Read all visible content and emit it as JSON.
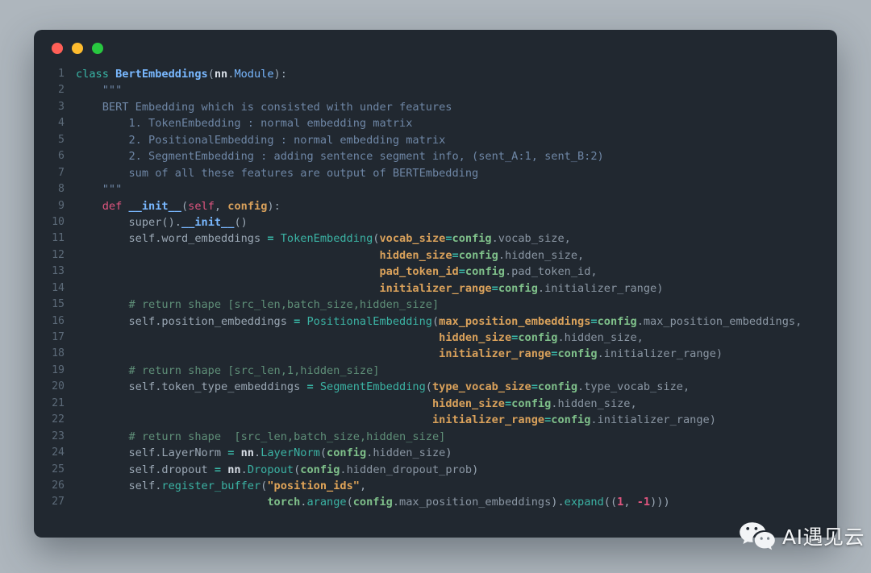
{
  "window": {
    "traffic_lights": [
      {
        "name": "close-button",
        "color": "#ff5f57"
      },
      {
        "name": "minimize-button",
        "color": "#febc2e"
      },
      {
        "name": "maximize-button",
        "color": "#28c840"
      }
    ]
  },
  "editor": {
    "background": "#212830",
    "page_background": "#aeb6bd",
    "language": "python",
    "line_numbers": [
      "1",
      "2",
      "3",
      "4",
      "5",
      "6",
      "7",
      "8",
      "9",
      "10",
      "11",
      "12",
      "13",
      "14",
      "15",
      "16",
      "17",
      "18",
      "19",
      "20",
      "21",
      "22",
      "23",
      "24",
      "25",
      "26",
      "27"
    ],
    "plain_text": "class BertEmbeddings(nn.Module):\n    \"\"\"\n    BERT Embedding which is consisted with under features\n        1. TokenEmbedding : normal embedding matrix\n        2. PositionalEmbedding : normal embedding matrix\n        2. SegmentEmbedding : adding sentence segment info, (sent_A:1, sent_B:2)\n        sum of all these features are output of BERTEmbedding\n    \"\"\"\n    def __init__(self, config):\n        super().__init__()\n        self.word_embeddings = TokenEmbedding(vocab_size=config.vocab_size,\n                                              hidden_size=config.hidden_size,\n                                              pad_token_id=config.pad_token_id,\n                                              initializer_range=config.initializer_range)\n        # return shape [src_len,batch_size,hidden_size]\n        self.position_embeddings = PositionalEmbedding(max_position_embeddings=config.max_position_embeddings,\n                                                       hidden_size=config.hidden_size,\n                                                       initializer_range=config.initializer_range)\n        # return shape [src_len,1,hidden_size]\n        self.token_type_embeddings = SegmentEmbedding(type_vocab_size=config.type_vocab_size,\n                                                      hidden_size=config.hidden_size,\n                                                      initializer_range=config.initializer_range)\n        # return shape  [src_len,batch_size,hidden_size]\n        self.LayerNorm = nn.LayerNorm(config.hidden_size)\n        self.dropout = nn.Dropout(config.hidden_dropout_prob)\n        self.register_buffer(\"position_ids\",\n                             torch.arange(config.max_position_embeddings).expand((1, -1)))",
    "lines": [
      {
        "n": "1",
        "tokens": [
          {
            "t": "class ",
            "c": "kw"
          },
          {
            "t": "BertEmbeddings",
            "c": "cls"
          },
          {
            "t": "(",
            "c": "punc"
          },
          {
            "t": "nn",
            "c": "white"
          },
          {
            "t": ".",
            "c": "punc"
          },
          {
            "t": "Module",
            "c": "type"
          },
          {
            "t": "):",
            "c": "punc"
          }
        ]
      },
      {
        "n": "2",
        "tokens": [
          {
            "t": "    \"\"\"",
            "c": "doc"
          }
        ]
      },
      {
        "n": "3",
        "tokens": [
          {
            "t": "    BERT Embedding which is consisted with under features",
            "c": "doc"
          }
        ]
      },
      {
        "n": "4",
        "tokens": [
          {
            "t": "        1. TokenEmbedding : normal embedding matrix",
            "c": "doc"
          }
        ]
      },
      {
        "n": "5",
        "tokens": [
          {
            "t": "        2. PositionalEmbedding : normal embedding matrix",
            "c": "doc"
          }
        ]
      },
      {
        "n": "6",
        "tokens": [
          {
            "t": "        2. SegmentEmbedding : adding sentence segment info, (sent_A:1, sent_B:2)",
            "c": "doc"
          }
        ]
      },
      {
        "n": "7",
        "tokens": [
          {
            "t": "        sum of all these features are output of BERTEmbedding",
            "c": "doc"
          }
        ]
      },
      {
        "n": "8",
        "tokens": [
          {
            "t": "    \"\"\"",
            "c": "doc"
          }
        ]
      },
      {
        "n": "9",
        "tokens": [
          {
            "t": "    ",
            "c": "plain"
          },
          {
            "t": "def ",
            "c": "def"
          },
          {
            "t": "__init__",
            "c": "funcb"
          },
          {
            "t": "(",
            "c": "punc"
          },
          {
            "t": "self",
            "c": "def"
          },
          {
            "t": ", ",
            "c": "punc"
          },
          {
            "t": "config",
            "c": "kwarg"
          },
          {
            "t": "):",
            "c": "punc"
          }
        ]
      },
      {
        "n": "10",
        "tokens": [
          {
            "t": "        super().",
            "c": "plain"
          },
          {
            "t": "__init__",
            "c": "funcb"
          },
          {
            "t": "()",
            "c": "punc"
          }
        ]
      },
      {
        "n": "11",
        "tokens": [
          {
            "t": "        self.word_embeddings ",
            "c": "plain"
          },
          {
            "t": "=",
            "c": "eq"
          },
          {
            "t": " ",
            "c": "plain"
          },
          {
            "t": "TokenEmbedding",
            "c": "func"
          },
          {
            "t": "(",
            "c": "punc"
          },
          {
            "t": "vocab_size",
            "c": "kwarg"
          },
          {
            "t": "=",
            "c": "eq"
          },
          {
            "t": "config",
            "c": "cfg"
          },
          {
            "t": ".vocab_size,",
            "c": "attr"
          }
        ]
      },
      {
        "n": "12",
        "tokens": [
          {
            "t": "                                              ",
            "c": "plain"
          },
          {
            "t": "hidden_size",
            "c": "kwarg"
          },
          {
            "t": "=",
            "c": "eq"
          },
          {
            "t": "config",
            "c": "cfg"
          },
          {
            "t": ".hidden_size,",
            "c": "attr"
          }
        ]
      },
      {
        "n": "13",
        "tokens": [
          {
            "t": "                                              ",
            "c": "plain"
          },
          {
            "t": "pad_token_id",
            "c": "kwarg"
          },
          {
            "t": "=",
            "c": "eq"
          },
          {
            "t": "config",
            "c": "cfg"
          },
          {
            "t": ".pad_token_id,",
            "c": "attr"
          }
        ]
      },
      {
        "n": "14",
        "tokens": [
          {
            "t": "                                              ",
            "c": "plain"
          },
          {
            "t": "initializer_range",
            "c": "kwarg"
          },
          {
            "t": "=",
            "c": "eq"
          },
          {
            "t": "config",
            "c": "cfg"
          },
          {
            "t": ".initializer_range)",
            "c": "attr"
          }
        ]
      },
      {
        "n": "15",
        "tokens": [
          {
            "t": "        # return shape [src_len,batch_size,hidden_size]",
            "c": "cmt"
          }
        ]
      },
      {
        "n": "16",
        "tokens": [
          {
            "t": "        self.position_embeddings ",
            "c": "plain"
          },
          {
            "t": "=",
            "c": "eq"
          },
          {
            "t": " ",
            "c": "plain"
          },
          {
            "t": "PositionalEmbedding",
            "c": "func"
          },
          {
            "t": "(",
            "c": "punc"
          },
          {
            "t": "max_position_embeddings",
            "c": "kwarg"
          },
          {
            "t": "=",
            "c": "eq"
          },
          {
            "t": "config",
            "c": "cfg"
          },
          {
            "t": ".max_position_embeddings,",
            "c": "attr"
          }
        ]
      },
      {
        "n": "17",
        "tokens": [
          {
            "t": "                                                       ",
            "c": "plain"
          },
          {
            "t": "hidden_size",
            "c": "kwarg"
          },
          {
            "t": "=",
            "c": "eq"
          },
          {
            "t": "config",
            "c": "cfg"
          },
          {
            "t": ".hidden_size,",
            "c": "attr"
          }
        ]
      },
      {
        "n": "18",
        "tokens": [
          {
            "t": "                                                       ",
            "c": "plain"
          },
          {
            "t": "initializer_range",
            "c": "kwarg"
          },
          {
            "t": "=",
            "c": "eq"
          },
          {
            "t": "config",
            "c": "cfg"
          },
          {
            "t": ".initializer_range)",
            "c": "attr"
          }
        ]
      },
      {
        "n": "19",
        "tokens": [
          {
            "t": "        # return shape [src_len,1,hidden_size]",
            "c": "cmt"
          }
        ]
      },
      {
        "n": "20",
        "tokens": [
          {
            "t": "        self.token_type_embeddings ",
            "c": "plain"
          },
          {
            "t": "=",
            "c": "eq"
          },
          {
            "t": " ",
            "c": "plain"
          },
          {
            "t": "SegmentEmbedding",
            "c": "func"
          },
          {
            "t": "(",
            "c": "punc"
          },
          {
            "t": "type_vocab_size",
            "c": "kwarg"
          },
          {
            "t": "=",
            "c": "eq"
          },
          {
            "t": "config",
            "c": "cfg"
          },
          {
            "t": ".type_vocab_size,",
            "c": "attr"
          }
        ]
      },
      {
        "n": "21",
        "tokens": [
          {
            "t": "                                                      ",
            "c": "plain"
          },
          {
            "t": "hidden_size",
            "c": "kwarg"
          },
          {
            "t": "=",
            "c": "eq"
          },
          {
            "t": "config",
            "c": "cfg"
          },
          {
            "t": ".hidden_size,",
            "c": "attr"
          }
        ]
      },
      {
        "n": "22",
        "tokens": [
          {
            "t": "                                                      ",
            "c": "plain"
          },
          {
            "t": "initializer_range",
            "c": "kwarg"
          },
          {
            "t": "=",
            "c": "eq"
          },
          {
            "t": "config",
            "c": "cfg"
          },
          {
            "t": ".initializer_range)",
            "c": "attr"
          }
        ]
      },
      {
        "n": "23",
        "tokens": [
          {
            "t": "        # return shape  [src_len,batch_size,hidden_size]",
            "c": "cmt"
          }
        ]
      },
      {
        "n": "24",
        "tokens": [
          {
            "t": "        self.LayerNorm ",
            "c": "plain"
          },
          {
            "t": "=",
            "c": "eq"
          },
          {
            "t": " ",
            "c": "plain"
          },
          {
            "t": "nn",
            "c": "white"
          },
          {
            "t": ".",
            "c": "punc"
          },
          {
            "t": "LayerNorm",
            "c": "func"
          },
          {
            "t": "(",
            "c": "punc"
          },
          {
            "t": "config",
            "c": "cfg"
          },
          {
            "t": ".hidden_size",
            "c": "attr"
          },
          {
            "t": ")",
            "c": "punc"
          }
        ]
      },
      {
        "n": "25",
        "tokens": [
          {
            "t": "        self.dropout ",
            "c": "plain"
          },
          {
            "t": "=",
            "c": "eq"
          },
          {
            "t": " ",
            "c": "plain"
          },
          {
            "t": "nn",
            "c": "white"
          },
          {
            "t": ".",
            "c": "punc"
          },
          {
            "t": "Dropout",
            "c": "func"
          },
          {
            "t": "(",
            "c": "punc"
          },
          {
            "t": "config",
            "c": "cfg"
          },
          {
            "t": ".hidden_dropout_prob",
            "c": "attr"
          },
          {
            "t": ")",
            "c": "punc"
          }
        ]
      },
      {
        "n": "26",
        "tokens": [
          {
            "t": "        self.",
            "c": "plain"
          },
          {
            "t": "register_buffer",
            "c": "func"
          },
          {
            "t": "(",
            "c": "punc"
          },
          {
            "t": "\"position_ids\"",
            "c": "str"
          },
          {
            "t": ",",
            "c": "punc"
          }
        ]
      },
      {
        "n": "27",
        "tokens": [
          {
            "t": "                             ",
            "c": "plain"
          },
          {
            "t": "torch",
            "c": "cfg"
          },
          {
            "t": ".",
            "c": "punc"
          },
          {
            "t": "arange",
            "c": "func"
          },
          {
            "t": "(",
            "c": "punc"
          },
          {
            "t": "config",
            "c": "cfg"
          },
          {
            "t": ".max_position_embeddings",
            "c": "attr"
          },
          {
            "t": ").",
            "c": "punc"
          },
          {
            "t": "expand",
            "c": "func"
          },
          {
            "t": "((",
            "c": "punc"
          },
          {
            "t": "1",
            "c": "num"
          },
          {
            "t": ", ",
            "c": "punc"
          },
          {
            "t": "-1",
            "c": "num"
          },
          {
            "t": ")))",
            "c": "punc"
          }
        ]
      }
    ]
  },
  "watermark": {
    "icon": "wechat-icon",
    "text": "AI遇见云"
  }
}
